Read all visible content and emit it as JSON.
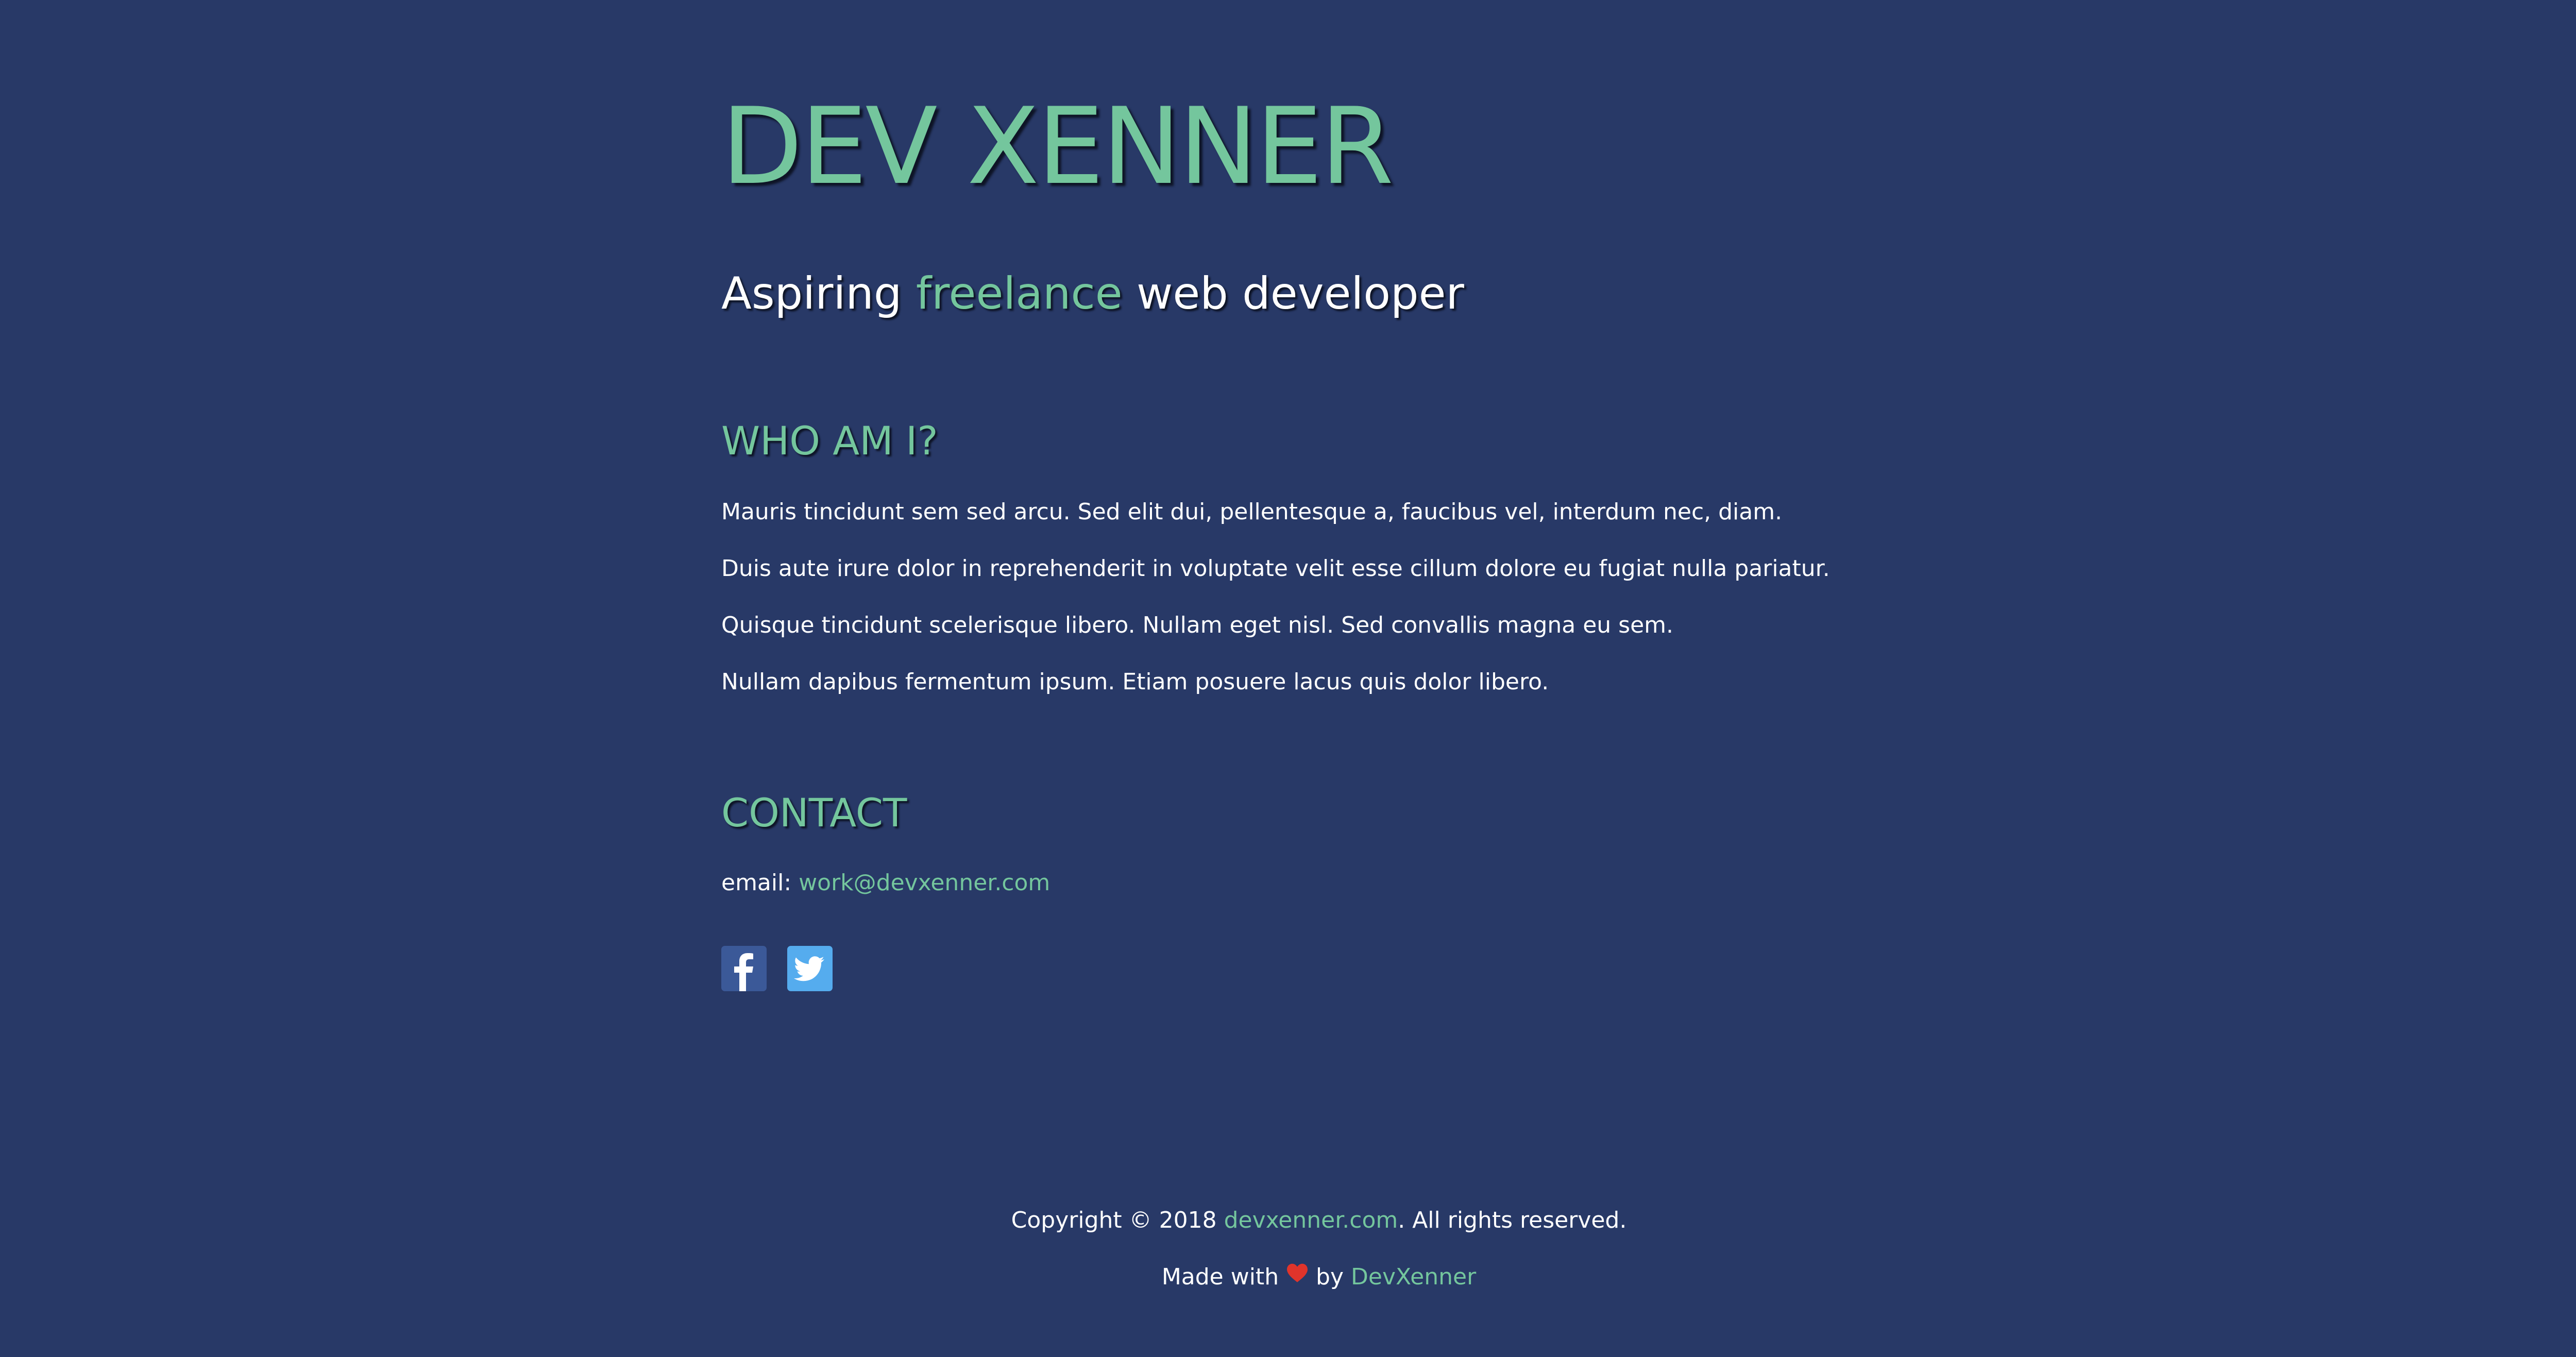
{
  "site": {
    "title": "DEV XENNER",
    "tagline_before": "Aspiring ",
    "tagline_accent": "freelance",
    "tagline_after": " web developer"
  },
  "about": {
    "heading": "WHO AM I?",
    "paragraphs": [
      "Mauris tincidunt sem sed arcu. Sed elit dui, pellentesque a, faucibus vel, interdum nec, diam.",
      "Duis aute irure dolor in reprehenderit in voluptate velit esse cillum dolore eu fugiat nulla pariatur.",
      "Quisque tincidunt scelerisque libero. Nullam eget nisl. Sed convallis magna eu sem.",
      "Nullam dapibus fermentum ipsum. Etiam posuere lacus quis dolor libero."
    ]
  },
  "contact": {
    "heading": "CONTACT",
    "email_label": "email: ",
    "email": "work@devxenner.com",
    "social": [
      {
        "name": "facebook-icon",
        "color": "#3b5998"
      },
      {
        "name": "twitter-icon",
        "color": "#55acee"
      }
    ]
  },
  "footer": {
    "copyright_before": "Copyright © 2018 ",
    "copyright_link": "devxenner.com",
    "copyright_after": ". All rights reserved.",
    "made_before": "Made with ",
    "heart_icon": "heart-icon",
    "made_middle": " by ",
    "made_link": "DevXenner"
  },
  "colors": {
    "background": "#283967",
    "accent": "#74c69d",
    "text": "#ffffff",
    "heart": "#e0342b"
  }
}
